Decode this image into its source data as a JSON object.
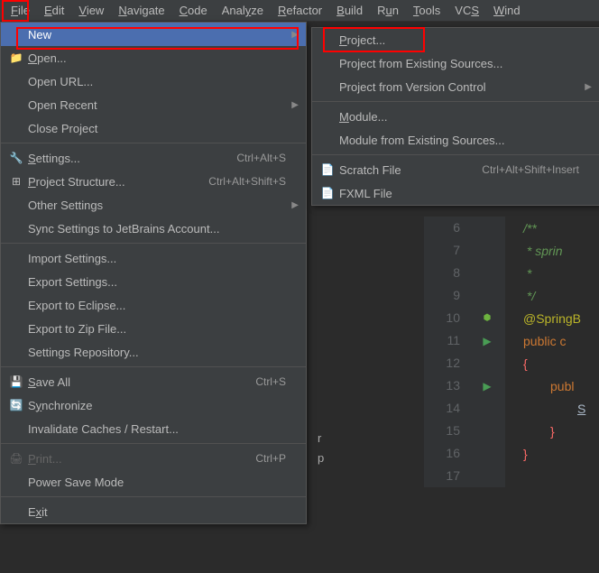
{
  "menubar": {
    "items": [
      {
        "label": "File",
        "mnemonic": 0
      },
      {
        "label": "Edit",
        "mnemonic": 0
      },
      {
        "label": "View",
        "mnemonic": 0
      },
      {
        "label": "Navigate",
        "mnemonic": 0
      },
      {
        "label": "Code",
        "mnemonic": 0
      },
      {
        "label": "Analyze",
        "mnemonic": 4
      },
      {
        "label": "Refactor",
        "mnemonic": 0
      },
      {
        "label": "Build",
        "mnemonic": 0
      },
      {
        "label": "Run",
        "mnemonic": 1
      },
      {
        "label": "Tools",
        "mnemonic": 0
      },
      {
        "label": "VCS",
        "mnemonic": 2
      },
      {
        "label": "Window",
        "mnemonic": 0
      }
    ]
  },
  "file_menu": {
    "new": "New",
    "open": "Open...",
    "open_url": "Open URL...",
    "open_recent": "Open Recent",
    "close_project": "Close Project",
    "settings": "Settings...",
    "settings_sc": "Ctrl+Alt+S",
    "proj_struct": "Project Structure...",
    "proj_struct_sc": "Ctrl+Alt+Shift+S",
    "other_settings": "Other Settings",
    "sync_jb": "Sync Settings to JetBrains Account...",
    "import_settings": "Import Settings...",
    "export_settings": "Export Settings...",
    "export_eclipse": "Export to Eclipse...",
    "export_zip": "Export to Zip File...",
    "settings_repo": "Settings Repository...",
    "save_all": "Save All",
    "save_all_sc": "Ctrl+S",
    "synchronize": "Synchronize",
    "invalidate": "Invalidate Caches / Restart...",
    "print": "Print...",
    "print_sc": "Ctrl+P",
    "power_save": "Power Save Mode",
    "exit": "Exit"
  },
  "new_menu": {
    "project": "Project...",
    "proj_existing": "Project from Existing Sources...",
    "proj_vcs": "Project from Version Control",
    "module": "Module...",
    "module_existing": "Module from Existing Sources...",
    "scratch": "Scratch File",
    "scratch_sc": "Ctrl+Alt+Shift+Insert",
    "fxml": "FXML File"
  },
  "editor": {
    "lines": [
      "6",
      "7",
      "8",
      "9",
      "10",
      "11",
      "12",
      "13",
      "14",
      "15",
      "16",
      "17"
    ],
    "code": {
      "l6": "/**",
      "l7": " * sprin",
      "l8": " *",
      "l9": " */",
      "l10": "@SpringB",
      "l11": "public c",
      "l12": "{",
      "l13": "publ",
      "l14": "S",
      "l15": "}",
      "l16": "}",
      "l17": ""
    }
  },
  "peek": {
    "r": "r",
    "p": "p"
  }
}
